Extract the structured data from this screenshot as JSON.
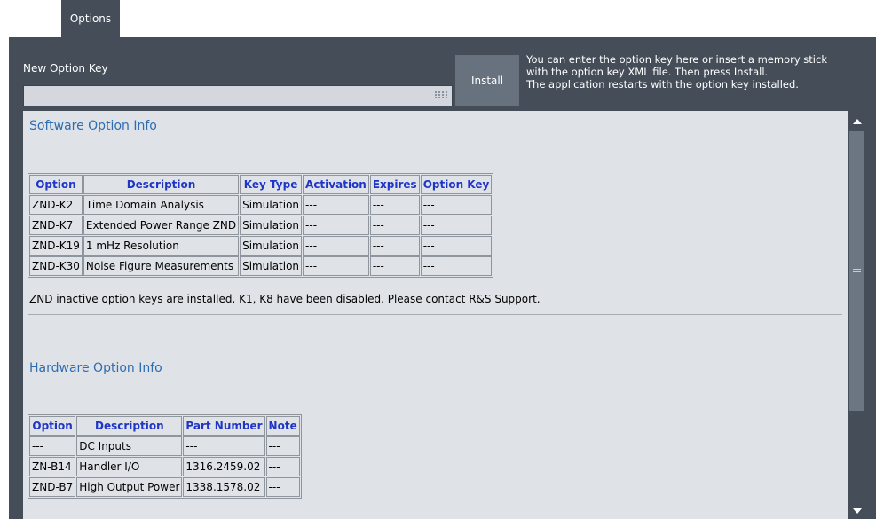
{
  "tab": {
    "label": "Options"
  },
  "new_key": {
    "label": "New Option Key",
    "value": "",
    "placeholder": ""
  },
  "install_button": {
    "label": "Install"
  },
  "help_text": [
    "You can enter the option key here or insert a memory stick",
    "with the option key XML file.  Then press Install.",
    "The application restarts with the option key installed."
  ],
  "software": {
    "title": "Software Option Info",
    "headers": [
      "Option",
      "Description",
      "Key Type",
      "Activation",
      "Expires",
      "Option Key"
    ],
    "rows": [
      [
        "ZND-K2",
        "Time Domain Analysis",
        "Simulation",
        "---",
        "---",
        "---"
      ],
      [
        "ZND-K7",
        "Extended Power Range ZND",
        "Simulation",
        "---",
        "---",
        "---"
      ],
      [
        "ZND-K19",
        "1 mHz Resolution",
        "Simulation",
        "---",
        "---",
        "---"
      ],
      [
        "ZND-K30",
        "Noise Figure Measurements",
        "Simulation",
        "---",
        "---",
        "---"
      ]
    ],
    "status": "ZND inactive option keys are installed. K1, K8 have been disabled. Please contact R&S Support."
  },
  "hardware": {
    "title": "Hardware Option Info",
    "headers": [
      "Option",
      "Description",
      "Part Number",
      "Note"
    ],
    "rows": [
      [
        "---",
        "DC Inputs",
        "---",
        "---"
      ],
      [
        "ZN-B14",
        "Handler I/O",
        "1316.2459.02",
        "---"
      ],
      [
        "ZND-B7",
        "High Output Power",
        "1338.1578.02",
        "---"
      ]
    ]
  },
  "icons": {
    "keyboard": "keyboard-icon",
    "scroll_up": "scroll-up-arrow-icon",
    "scroll_down": "scroll-down-arrow-icon",
    "scroll_grip": "scroll-grip-icon"
  },
  "colors": {
    "panel_bg": "#444d58",
    "info_bg": "#dfe3e8",
    "section_title": "#2f6cb0",
    "table_header": "#1f35c8",
    "button_bg": "#67727e"
  }
}
